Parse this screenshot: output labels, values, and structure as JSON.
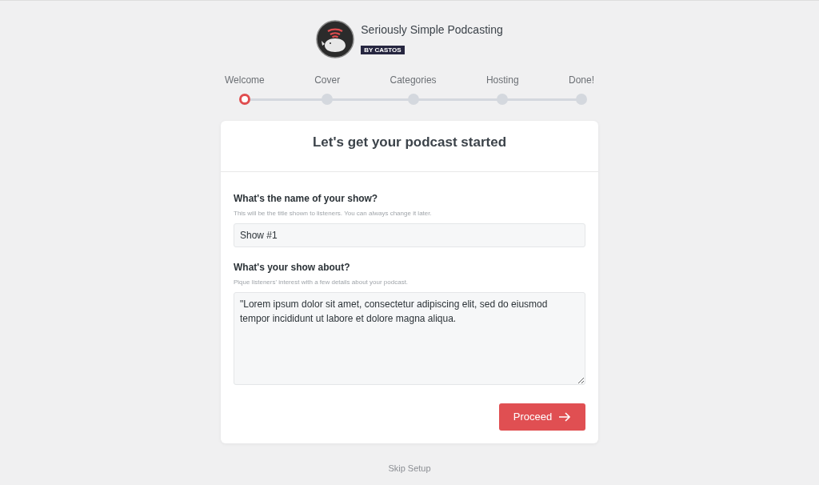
{
  "brand": {
    "name": "Seriously Simple Podcasting",
    "tag": "BY CASTOS"
  },
  "steps": [
    {
      "label": "Welcome",
      "selected": true
    },
    {
      "label": "Cover",
      "selected": false
    },
    {
      "label": "Categories",
      "selected": false
    },
    {
      "label": "Hosting",
      "selected": false
    },
    {
      "label": "Done!",
      "selected": false
    }
  ],
  "card": {
    "title": "Let's get your podcast started",
    "fields": [
      {
        "kind": "input",
        "label": "What's the name of your show?",
        "hint": "This will be the title shown to listeners. You can always change it later.",
        "value": "Show #1"
      },
      {
        "kind": "textarea",
        "label": "What's your show about?",
        "hint": "Pique listeners' interest with a few details about your podcast.",
        "value": "\"Lorem ipsum dolor sit amet, consectetur adipiscing elit, sed do eiusmod tempor incididunt ut labore et dolore magna aliqua."
      }
    ],
    "button": "Proceed"
  },
  "skip": "Skip Setup"
}
